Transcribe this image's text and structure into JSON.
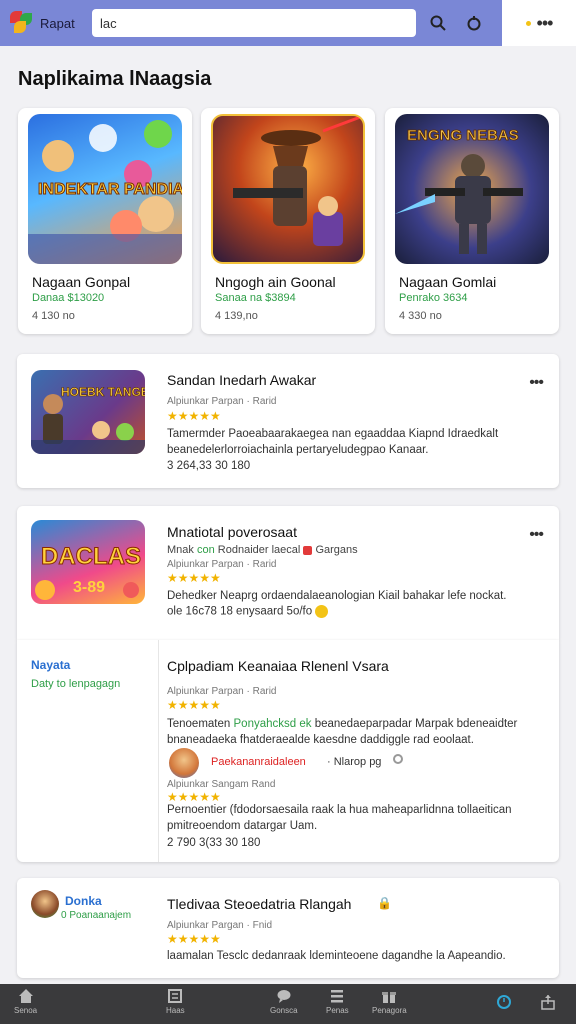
{
  "topbar": {
    "brand": "Rapat",
    "search_value": "lac",
    "colors": {
      "bar": "#7a87d6",
      "accent": "#2e9e47",
      "star": "#f1b300"
    }
  },
  "section_title": "Naplikaima lNaagsia",
  "featured": [
    {
      "name": "Nagaan Gonpal",
      "sub": "Danaa $13020",
      "meta": "4 130 no"
    },
    {
      "name": "Nngogh ain Goonal",
      "sub": "Sanaa na $3894",
      "meta": "4 139,no"
    },
    {
      "name": "Nagaan Gomlai",
      "sub": "Penrako 3634",
      "meta": "4 330 no"
    }
  ],
  "art_text": {
    "card1": "INDEKTAR PANDIA",
    "card2": "ENGNG NEBAS",
    "list1": "HOEBK TANGBAR",
    "list2": "DACLAS",
    "list2_num": "3-89"
  },
  "list": [
    {
      "title": "Sandan Inedarh Awakar",
      "line": "Alpiunkar Parpan · Rarid",
      "stars": "★★★★★",
      "desc": "Tamermder Paoeabaarakaegea nan egaaddaa Kiapnd Idraedkalt beanedelerlorroiachainla pertaryeludegpao Kanaar.",
      "meta": "3 264,33 30 180"
    },
    {
      "title": "Mnatiotal poverosaat",
      "line_a": "Mnak",
      "line_b": "con",
      "line_c": "Rodnaider laecal",
      "line_d": "Gargans",
      "line2": "Alpiunkar Parpan · Rarid",
      "stars": "★★★★★",
      "desc": "Dehedker Neaprg ordaendalaeanologian Kiail bahakar lefe nockat.",
      "meta": "ole 16c78 18 enysaard 5o/fo"
    }
  ],
  "review_block": {
    "side_title": "Nayata",
    "side_sub": "Daty to lenpagagn",
    "title": "Cplpadiam Keanaiaa Rlenenl Vsara",
    "line": "Alpiunkar Parpan · Rarid",
    "stars": "★★★★★",
    "desc_a": "Tenoematen",
    "desc_highlight": "Ponyahcksd ek",
    "desc_b": "beanedaeparpadar Marpak bdeneaidter bnaneadaeka fhatderaealde kaesdne daddiggle rad eoolaat.",
    "reviewer_name": "Paekananraidaleen",
    "reviewer_meta": "Nlarop pg",
    "reviewer_line": "Alpiunkar Sangam Rand",
    "reviewer_stars": "★★★★★",
    "reviewer_desc": "Pernoentier (fdodorsaesaila raak la hua maheaparlidnna tollaeitican pmitreoendom datargar Uam.",
    "meta": "2 790 3(33 30 180"
  },
  "last_card": {
    "side_title": "Donka",
    "side_sub": "0 Poanaanajem",
    "title": "Tledivaa Steoedatria Rlangah",
    "line": "Alpiunkar Pargan · Fnid",
    "stars": "★★★★★",
    "desc": "laamalan Tesclc dedanraak ldeminteoene dagandhe la Aapeandio."
  },
  "bottom_nav": [
    {
      "label": "Senoa",
      "icon": "home-icon"
    },
    {
      "label": "Haas",
      "icon": "news-icon"
    },
    {
      "label": "Gonsca",
      "icon": "chat-icon"
    },
    {
      "label": "Penas",
      "icon": "list-icon"
    },
    {
      "label": "Penagora",
      "icon": "gift-icon"
    },
    {
      "label": "",
      "icon": "clock-icon"
    },
    {
      "label": "",
      "icon": "share-icon"
    }
  ]
}
